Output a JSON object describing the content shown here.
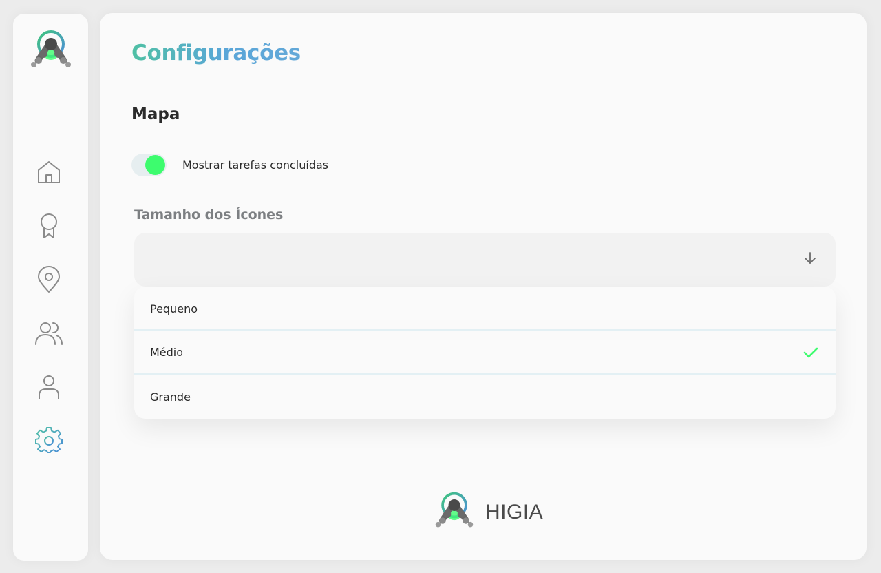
{
  "colors": {
    "accent_green": "#3dfc6e",
    "title_gradient_start": "#4fc0a4",
    "title_gradient_end": "#5aa6d8",
    "icon_gray": "#8a8a8a"
  },
  "sidebar": {
    "items": [
      {
        "name": "home",
        "icon": "home-icon",
        "active": false
      },
      {
        "name": "achievements",
        "icon": "award-ribbon-icon",
        "active": false
      },
      {
        "name": "map",
        "icon": "map-pin-icon",
        "active": false
      },
      {
        "name": "community",
        "icon": "users-icon",
        "active": false
      },
      {
        "name": "profile",
        "icon": "user-icon",
        "active": false
      },
      {
        "name": "settings",
        "icon": "gear-icon",
        "active": true
      }
    ]
  },
  "page": {
    "title": "Configurações",
    "section_title": "Mapa"
  },
  "show_completed": {
    "label": "Mostrar tarefas concluídas",
    "enabled": true
  },
  "icon_size": {
    "label": "Tamanho dos Ícones",
    "value": "",
    "options": [
      "Pequeno",
      "Médio",
      "Grande"
    ],
    "selected": "Médio"
  },
  "footer": {
    "brand": "HIGIA"
  }
}
